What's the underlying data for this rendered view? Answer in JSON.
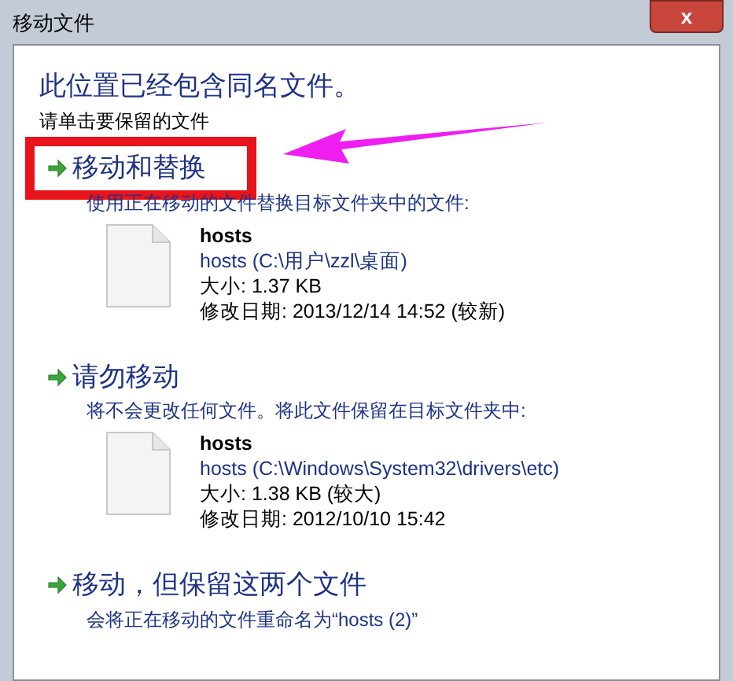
{
  "window": {
    "title": "移动文件",
    "close": "x"
  },
  "heading": "此位置已经包含同名文件。",
  "instruction": "请单击要保留的文件",
  "options": [
    {
      "title": "移动和替换",
      "description": "使用正在移动的文件替换目标文件夹中的文件:",
      "highlighted": true,
      "file": {
        "name": "hosts",
        "path": "hosts (C:\\用户\\zzl\\桌面)",
        "size": "大小: 1.37 KB",
        "modified": "修改日期: 2013/12/14 14:52 (较新)"
      }
    },
    {
      "title": "请勿移动",
      "description": "将不会更改任何文件。将此文件保留在目标文件夹中:",
      "highlighted": false,
      "file": {
        "name": "hosts",
        "path": "hosts (C:\\Windows\\System32\\drivers\\etc)",
        "size": "大小: 1.38 KB (较大)",
        "modified": "修改日期: 2012/10/10 15:42"
      }
    },
    {
      "title": "移动，但保留这两个文件",
      "description": "会将正在移动的文件重命名为“hosts (2)”",
      "highlighted": false
    }
  ]
}
